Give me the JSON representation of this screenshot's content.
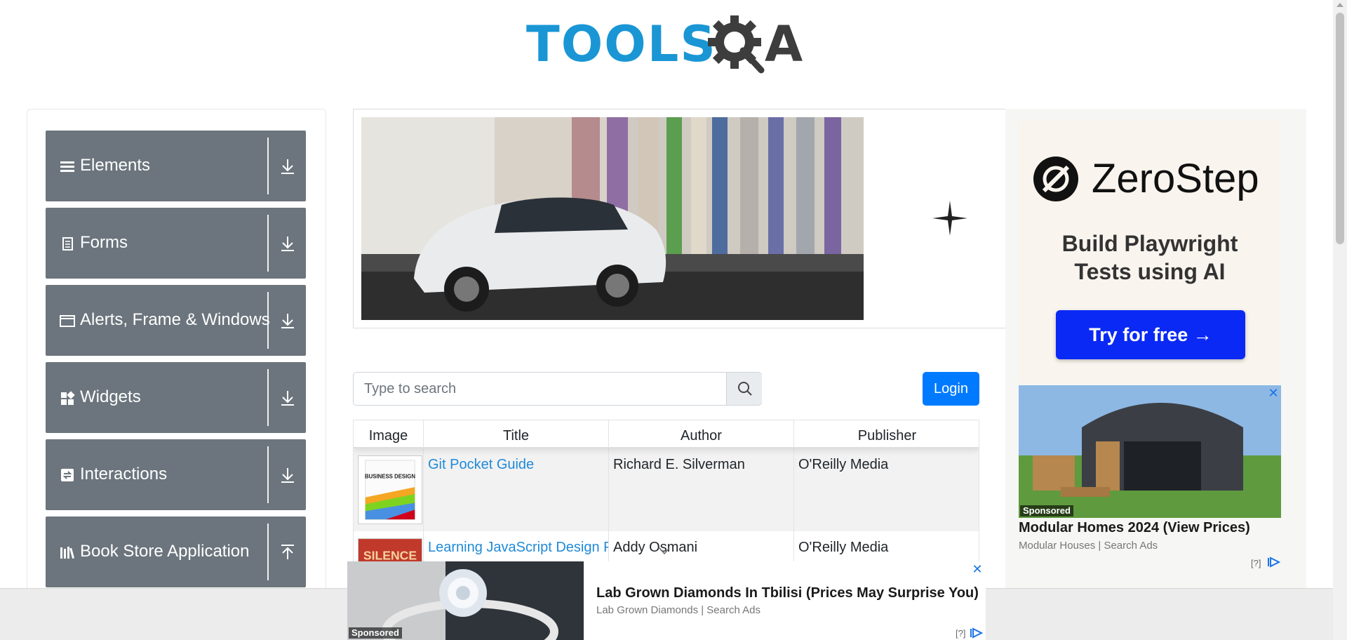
{
  "header": {
    "logo_text_left": "TOOLS",
    "logo_text_right": "A"
  },
  "sidebar": {
    "groups": [
      {
        "label": "Elements",
        "icon": "menu-icon",
        "arrow": "down"
      },
      {
        "label": "Forms",
        "icon": "document-icon",
        "arrow": "down"
      },
      {
        "label": "Alerts, Frame & Windows",
        "icon": "window-icon",
        "arrow": "down"
      },
      {
        "label": "Widgets",
        "icon": "widgets-icon",
        "arrow": "down"
      },
      {
        "label": "Interactions",
        "icon": "interaction-icon",
        "arrow": "down"
      },
      {
        "label": "Book Store Application",
        "icon": "books-icon",
        "arrow": "up"
      }
    ]
  },
  "search": {
    "placeholder": "Type to search",
    "value": ""
  },
  "login": {
    "label": "Login"
  },
  "table": {
    "columns": [
      "Image",
      "Title",
      "Author",
      "Publisher"
    ],
    "rows": [
      {
        "title": "Git Pocket Guide",
        "author": "Richard E. Silverman",
        "publisher": "O'Reilly Media",
        "cover_text": "BUSINESS DESIGN"
      },
      {
        "title": "Learning JavaScript Design Patterns",
        "author": "Addy Osmani",
        "publisher": "O'Reilly Media",
        "cover_text": "SILENCE"
      }
    ]
  },
  "right_ad": {
    "brand": "ZeroStep",
    "tagline_line1": "Build Playwright",
    "tagline_line2": "Tests using AI",
    "cta": "Try for free →",
    "second_title": "Modular Homes 2024 (View Prices)",
    "second_source": "Modular Houses | Search Ads",
    "sponsored": "Sponsored",
    "q_mark": "[?]"
  },
  "bottom_ad": {
    "title": "Lab Grown Diamonds In Tbilisi (Prices May Surprise You)",
    "source": "Lab Grown Diamonds | Search Ads",
    "sponsored": "Sponsored",
    "q_mark": "[?]"
  },
  "colors": {
    "sidebar_group": "#6c757d",
    "primary": "#007bff",
    "link": "#1f8ad8",
    "logo_blue": "#1a96d4",
    "cta_blue": "#0a29f5"
  }
}
